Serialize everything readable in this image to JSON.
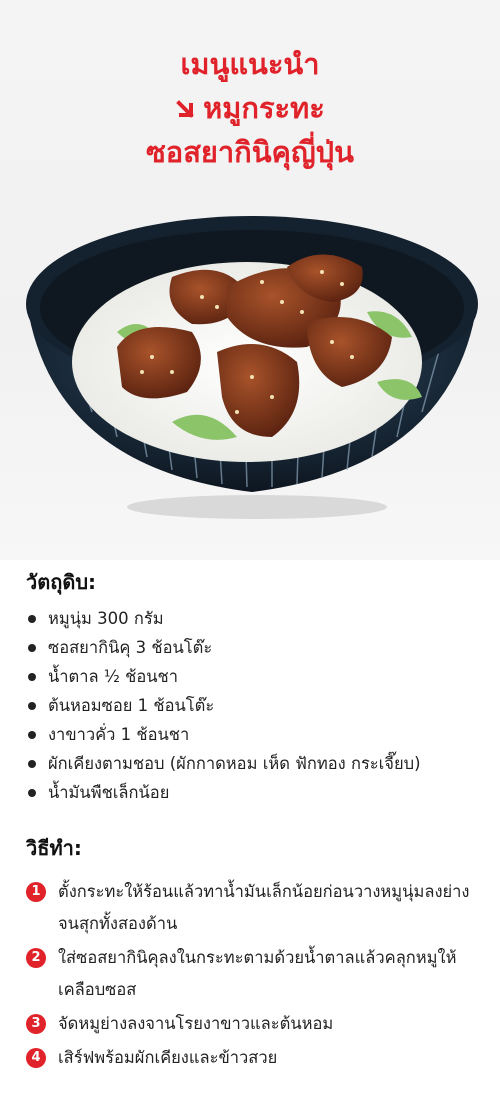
{
  "header": {
    "title_line1": "เมนูแนะนำ",
    "title_line2": "หมูกระทะ",
    "title_line3": "ซอสยากินิคุญี่ปุ่น"
  },
  "ingredients": {
    "heading": "วัตถุดิบ:",
    "items": [
      "หมูนุ่ม 300 กรัม",
      "ซอสยากินิคุ 3 ช้อนโต๊ะ",
      "น้ำตาล ½ ช้อนชา",
      "ต้นหอมซอย 1 ช้อนโต๊ะ",
      "งาขาวคั่ว 1 ช้อนชา",
      "ผักเคียงตามชอบ (ผักกาดหอม เห็ด ฟักทอง กระเจี๊ยบ)",
      "น้ำมันพืชเล็กน้อย"
    ]
  },
  "method": {
    "heading": "วิธีทำ:",
    "steps": [
      {
        "num": "1",
        "text": "ตั้งกระทะให้ร้อนแล้วทาน้ำมันเล็กน้อยก่อนวางหมูนุ่มลงย่างจนสุกทั้งสองด้าน"
      },
      {
        "num": "2",
        "text": "ใส่ซอสยากินิคุลงในกระทะตามด้วยน้ำตาลแล้วคลุกหมูให้เคลือบซอส"
      },
      {
        "num": "3",
        "text": "จัดหมูย่างลงจานโรยงาขาวและต้นหอม"
      },
      {
        "num": "4",
        "text": "เสิร์ฟพร้อมผักเคียงและข้าวสวย"
      }
    ]
  },
  "colors": {
    "accent": "#e0232a",
    "text": "#222222"
  }
}
